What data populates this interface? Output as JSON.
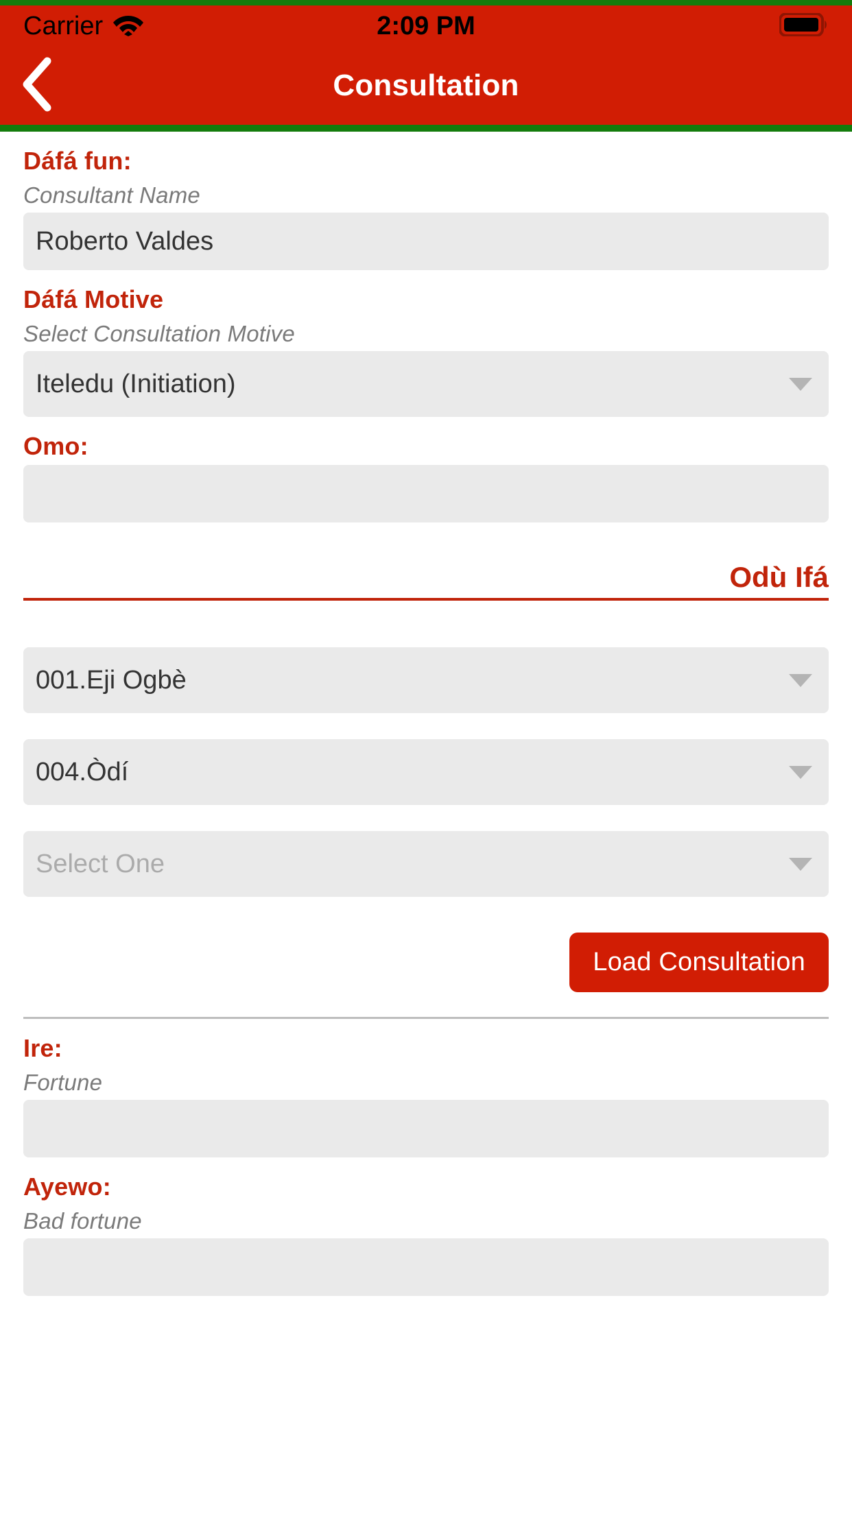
{
  "status_bar": {
    "carrier": "Carrier",
    "wifi_icon": "wifi-icon",
    "time": "2:09 PM",
    "battery_icon": "battery-full-icon"
  },
  "nav_bar": {
    "back_icon": "chevron-left-icon",
    "title": "Consultation"
  },
  "colors": {
    "brand_red": "#D11D04",
    "label_red": "#C1240A",
    "accent_green": "#147C0C",
    "field_bg": "#EAEAEA",
    "hint_gray": "#7A7A7A",
    "placeholder_gray": "#ABABAB",
    "divider_gray": "#BDBDBD"
  },
  "form": {
    "consultant": {
      "label": "Dáfá fun:",
      "hint": "Consultant Name",
      "value": "Roberto Valdes"
    },
    "motive": {
      "label": "Dáfá Motive",
      "hint": "Select Consultation Motive",
      "value": "Iteledu (Initiation)",
      "caret_icon": "chevron-down-icon"
    },
    "omo": {
      "label": "Omo:",
      "value": ""
    },
    "odu_section": {
      "heading": "Odù Ifá",
      "selects": [
        {
          "value": "001.Eji Ogbè",
          "is_placeholder": false,
          "caret_icon": "chevron-down-icon"
        },
        {
          "value": "004.Òdí",
          "is_placeholder": false,
          "caret_icon": "chevron-down-icon"
        },
        {
          "value": "Select One",
          "is_placeholder": true,
          "caret_icon": "chevron-down-icon"
        }
      ],
      "load_button_label": "Load Consultation"
    },
    "ire": {
      "label": "Ire:",
      "hint": "Fortune",
      "value": ""
    },
    "ayewo": {
      "label": "Ayewo:",
      "hint": "Bad fortune",
      "value": ""
    }
  }
}
